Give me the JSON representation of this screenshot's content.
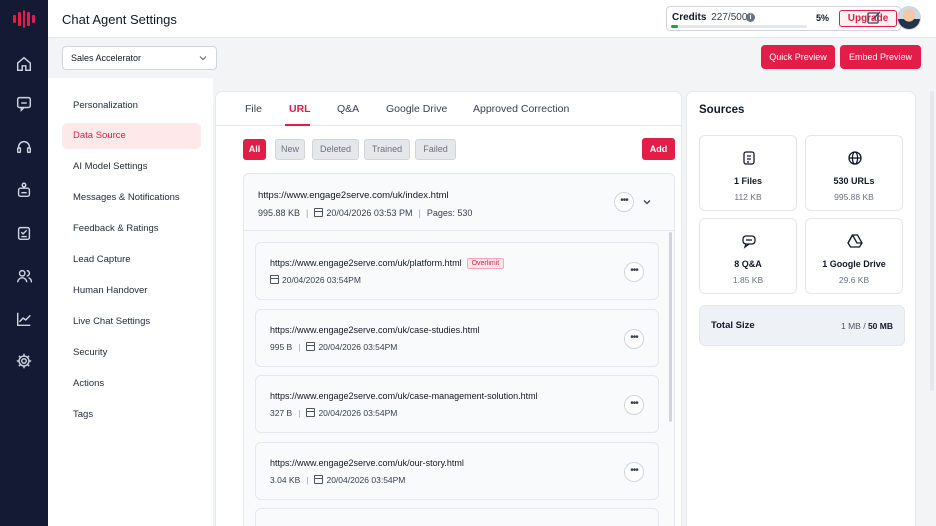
{
  "header": {
    "title": "Chat Agent Settings",
    "credits_label": "Credits",
    "credits_value": "227/5000",
    "credits_percent_text": "5%",
    "credits_fraction": 0.05,
    "upgrade_label": "Upgrade",
    "accent_color": "#e11d48"
  },
  "toolbar": {
    "agent_select_value": "Sales Accelerator",
    "quick_preview_label": "Quick Preview",
    "embed_preview_label": "Embed Preview"
  },
  "rail_icons": [
    "home-icon",
    "chat-icon",
    "headset-icon",
    "bot-icon",
    "clipboard-icon",
    "users-icon",
    "chart-icon",
    "settings-icon"
  ],
  "menu": {
    "items": [
      {
        "label": "Personalization"
      },
      {
        "label": "Data Source"
      },
      {
        "label": "AI Model Settings"
      },
      {
        "label": "Messages & Notifications"
      },
      {
        "label": "Feedback & Ratings"
      },
      {
        "label": "Lead Capture"
      },
      {
        "label": "Human Handover"
      },
      {
        "label": "Live Chat Settings"
      },
      {
        "label": "Security"
      },
      {
        "label": "Actions"
      },
      {
        "label": "Tags"
      }
    ],
    "active": "Data Source"
  },
  "tabs": {
    "items": [
      {
        "label": "File"
      },
      {
        "label": "URL"
      },
      {
        "label": "Q&A"
      },
      {
        "label": "Google Drive"
      },
      {
        "label": "Approved Correction"
      }
    ],
    "active": "URL"
  },
  "filters": {
    "items": [
      {
        "label": "All"
      },
      {
        "label": "New"
      },
      {
        "label": "Deleted"
      },
      {
        "label": "Trained"
      },
      {
        "label": "Failed"
      }
    ],
    "active": "All",
    "add_label": "Add"
  },
  "url_group": {
    "url": "https://www.engage2serve.com/uk/index.html",
    "size": "995.88 KB",
    "date": "20/04/2026 03:53 PM",
    "pages": "Pages: 530",
    "children": [
      {
        "url": "https://www.engage2serve.com/uk/platform.html",
        "badge": "Overlimit",
        "size": "",
        "date": "20/04/2026 03:54PM"
      },
      {
        "url": "https://www.engage2serve.com/uk/case-studies.html",
        "badge": "",
        "size": "995 B",
        "date": "20/04/2026 03:54PM"
      },
      {
        "url": "https://www.engage2serve.com/uk/case-management-solution.html",
        "badge": "",
        "size": "327 B",
        "date": "20/04/2026 03:54PM"
      },
      {
        "url": "https://www.engage2serve.com/uk/our-story.html",
        "badge": "",
        "size": "3.04 KB",
        "date": "20/04/2026 03:54PM"
      }
    ]
  },
  "sources": {
    "title": "Sources",
    "cards": [
      {
        "icon": "file-icon",
        "label": "1 Files",
        "size": "112 KB"
      },
      {
        "icon": "globe-icon",
        "label": "530 URLs",
        "size": "995.88 KB"
      },
      {
        "icon": "qa-icon",
        "label": "8 Q&A",
        "size": "1.85 KB"
      },
      {
        "icon": "google-drive-icon",
        "label": "1 Google Drive",
        "size": "29.6 KB"
      }
    ],
    "total_label": "Total Size",
    "total_used": "1 MB",
    "total_sep": " / ",
    "total_max": "50 MB"
  }
}
